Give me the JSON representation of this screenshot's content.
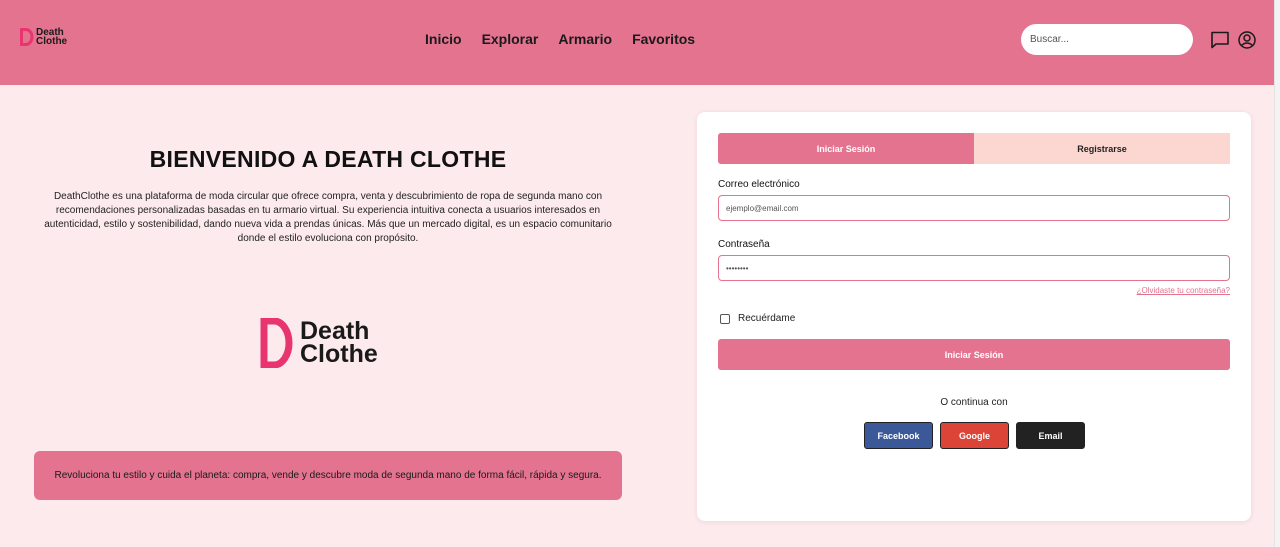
{
  "brand": {
    "name_line1": "Death",
    "name_line2": "Clothe",
    "accent": "#e3738e",
    "logo_color": "#e8356f"
  },
  "nav": {
    "items": [
      {
        "label": "Inicio"
      },
      {
        "label": "Explorar"
      },
      {
        "label": "Armario"
      },
      {
        "label": "Favoritos"
      }
    ]
  },
  "search": {
    "placeholder": "Buscar..."
  },
  "header_icons": {
    "chat": "chat-icon",
    "user": "user-icon"
  },
  "welcome": {
    "title": "BIENVENIDO A DEATH CLOTHE",
    "description": "DeathClothe es una plataforma de moda circular que ofrece compra, venta y descubrimiento de ropa de segunda mano con recomendaciones personalizadas basadas en tu armario virtual. Su experiencia intuitiva conecta a usuarios interesados en autenticidad, estilo y sostenibilidad, dando nueva vida a prendas únicas. Más que un mercado digital, es un espacio comunitario donde el estilo evoluciona con propósito."
  },
  "banner": {
    "text": "Revoluciona tu estilo y cuida el planeta: compra, vende y descubre moda de segunda mano de forma fácil, rápida y segura."
  },
  "auth": {
    "tabs": {
      "login": "Iniciar Sesión",
      "register": "Registrarse"
    },
    "email_label": "Correo electrónico",
    "email_placeholder": "ejemplo@email.com",
    "password_label": "Contraseña",
    "password_placeholder": "••••••••",
    "forgot": "¿Olvidaste tu contraseña?",
    "remember": "Recuérdame",
    "submit": "Iniciar Sesión",
    "continue_with": "O continua con",
    "social": {
      "facebook": "Facebook",
      "google": "Google",
      "email": "Email"
    }
  }
}
